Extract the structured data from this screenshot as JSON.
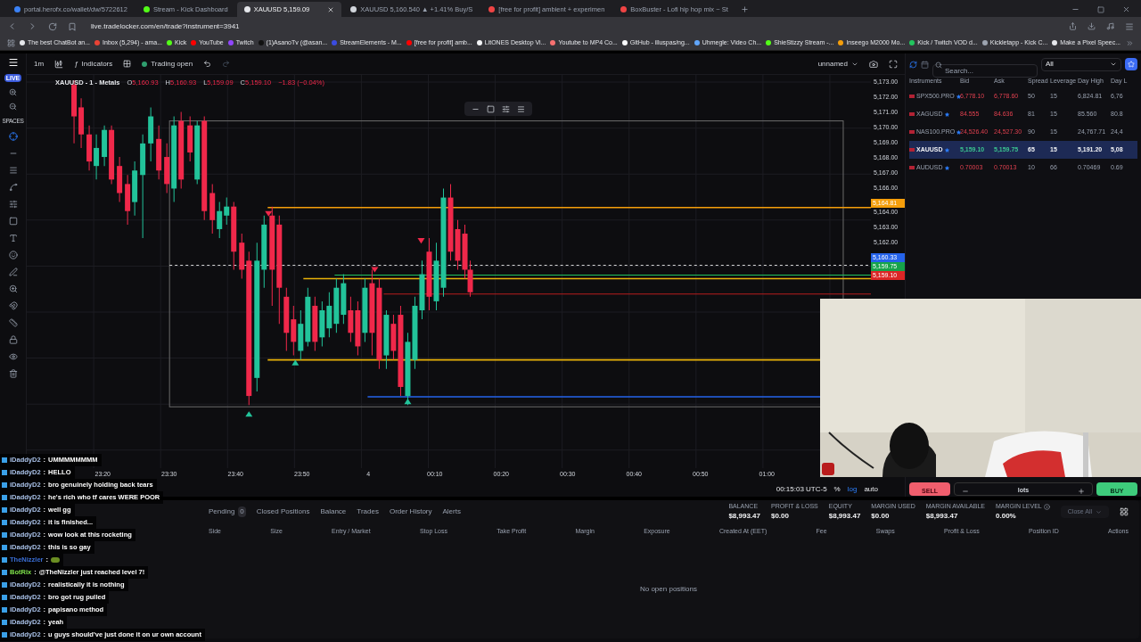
{
  "browser": {
    "tabs": [
      {
        "title": "portal.herofx.co/wallet/dw/5722612",
        "selected": false,
        "color": "#3b82f6"
      },
      {
        "title": "Stream - Kick Dashboard",
        "selected": false,
        "color": "#53fc18"
      },
      {
        "title": "XAUUSD 5,159.09",
        "selected": true,
        "color": "#e5e7eb"
      },
      {
        "title": "XAUUSD 5,160.540 ▲ +1.41% Buy/S",
        "selected": false,
        "color": "#d1d5db"
      },
      {
        "title": "[free for profit] ambient + experimen",
        "selected": false,
        "color": "#ef4444"
      },
      {
        "title": "BoxBuster - Lofi hip hop mix ~ St",
        "selected": false,
        "color": "#ef4444"
      }
    ],
    "address": "live.tradelocker.com/en/trade?instrument=3941",
    "bookmarks": [
      {
        "label": "The best ChatBot an...",
        "color": "#e5e7eb"
      },
      {
        "label": "Inbox (5,294) - ama...",
        "color": "#ea4335"
      },
      {
        "label": "Kick",
        "color": "#53fc18"
      },
      {
        "label": "YouTube",
        "color": "#ff0000"
      },
      {
        "label": "Twitch",
        "color": "#9146ff"
      },
      {
        "label": "(1)AsanoTv (@asan...",
        "color": "#111111"
      },
      {
        "label": "StreamElements - M...",
        "color": "#3b4ce0"
      },
      {
        "label": "[free for profit] amb...",
        "color": "#ff0000"
      },
      {
        "label": "LitONES Desktop Vi...",
        "color": "#f3f4f6"
      },
      {
        "label": "Youtube to MP4 Co...",
        "color": "#f87171"
      },
      {
        "label": "GitHub - illuspas/ng...",
        "color": "#f9fafb"
      },
      {
        "label": "Uhmegle: Video Ch...",
        "color": "#60a5fa"
      },
      {
        "label": "ShieStizzy Stream -...",
        "color": "#53fc18"
      },
      {
        "label": "Inseego M2000 Mo...",
        "color": "#f59e0b"
      },
      {
        "label": "Kick / Twitch VOD d...",
        "color": "#22c55e"
      },
      {
        "label": "Kickletapp - Kick C...",
        "color": "#9ca3af"
      },
      {
        "label": "Make a Pixel Speec...",
        "color": "#e5e7eb"
      }
    ]
  },
  "sidebar": {
    "badge": "LIVE",
    "section": "SPACES"
  },
  "chart_toolbar": {
    "interval": "1m",
    "function_glyph": "ƒ",
    "indicators": "Indicators",
    "status": "Trading open",
    "layout": "unnamed"
  },
  "legend": {
    "symbol": "XAUUSD - 1 - Metals",
    "values": [
      {
        "key": "O",
        "value": "5,160.93"
      },
      {
        "key": "H",
        "value": "5,160.93"
      },
      {
        "key": "L",
        "value": "5,159.09"
      },
      {
        "key": "C",
        "value": "5,159.10"
      }
    ],
    "change": "−1.83 (−0.04%)"
  },
  "price_axis": [
    {
      "label": "5,173.00",
      "kind": "tick"
    },
    {
      "label": "5,172.00",
      "kind": "tick"
    },
    {
      "label": "5,171.00",
      "kind": "tick"
    },
    {
      "label": "5,170.00",
      "kind": "tick"
    },
    {
      "label": "5,169.00",
      "kind": "tick"
    },
    {
      "label": "5,168.00",
      "kind": "tick"
    },
    {
      "label": "5,167.00",
      "kind": "tick"
    },
    {
      "label": "5,166.00",
      "kind": "tick"
    },
    {
      "label": "5,164.81",
      "kind": "badge",
      "color": "#f59e0b"
    },
    {
      "label": "5,164.00",
      "kind": "tick"
    },
    {
      "label": "5,163.00",
      "kind": "tick"
    },
    {
      "label": "5,162.00",
      "kind": "tick"
    },
    {
      "label": "5,160.33",
      "kind": "badge",
      "color": "#2563eb"
    },
    {
      "label": "5,159.75",
      "kind": "badge",
      "color": "#16a34a"
    },
    {
      "label": "5,159.10",
      "kind": "badge",
      "color": "#dc2626"
    }
  ],
  "time_axis": [
    "23:20",
    "23:30",
    "23:40",
    "23:50",
    "4",
    "00:10",
    "00:20",
    "00:30",
    "00:40",
    "00:50",
    "01:00"
  ],
  "chart_footer": {
    "clock": "00:15:03 UTC-5",
    "scales": [
      {
        "label": "%",
        "selected": false
      },
      {
        "label": "log",
        "selected": true
      },
      {
        "label": "auto",
        "selected": false
      }
    ]
  },
  "instruments": {
    "search_placeholder": "Search...",
    "filter": "All",
    "columns": [
      "Instruments",
      "Bid",
      "Ask",
      "Spread",
      "Leverage",
      "Day High",
      "Day L"
    ],
    "rows": [
      {
        "symbol": "SPX500.PRO",
        "bid": "6,778.10",
        "ask": "6,778.60",
        "spread": "50",
        "leverage": "15",
        "day_high": "6,824.81",
        "day_low": "6,76",
        "selected": false
      },
      {
        "symbol": "XAGUSD",
        "bid": "84.555",
        "ask": "84.636",
        "spread": "81",
        "leverage": "15",
        "day_high": "85.560",
        "day_low": "80.8",
        "selected": false
      },
      {
        "symbol": "NAS100.PRO",
        "bid": "24,526.40",
        "ask": "24,527.30",
        "spread": "90",
        "leverage": "15",
        "day_high": "24,767.71",
        "day_low": "24,4",
        "selected": false
      },
      {
        "symbol": "XAUUSD",
        "bid": "5,159.10",
        "ask": "5,159.75",
        "spread": "65",
        "leverage": "15",
        "day_high": "5,191.20",
        "day_low": "5,08",
        "selected": true
      },
      {
        "symbol": "AUDUSD",
        "bid": "0.70003",
        "ask": "0.70013",
        "spread": "10",
        "leverage": "66",
        "day_high": "0.70469",
        "day_low": "0.69",
        "selected": false
      }
    ]
  },
  "order_bar": {
    "sell": "SELL",
    "lots": "lots",
    "buy": "BUY"
  },
  "positions": {
    "tabs": [
      {
        "label": "Pending",
        "count": "0",
        "selected": false
      },
      {
        "label": "Closed Positions",
        "selected": false
      },
      {
        "label": "Balance",
        "selected": false
      },
      {
        "label": "Trades",
        "selected": false
      },
      {
        "label": "Order History",
        "selected": false
      },
      {
        "label": "Alerts",
        "selected": false
      }
    ],
    "summary": [
      {
        "label": "BALANCE",
        "value": "$8,993.47"
      },
      {
        "label": "PROFIT & LOSS",
        "value": "$0.00"
      },
      {
        "label": "EQUITY",
        "value": "$8,993.47"
      },
      {
        "label": "MARGIN USED",
        "value": "$0.00"
      },
      {
        "label": "MARGIN AVAILABLE",
        "value": "$8,993.47"
      },
      {
        "label": "MARGIN LEVEL",
        "value": "0.00%"
      }
    ],
    "close_all": {
      "label": "Close All",
      "disabled": true
    },
    "columns": [
      "Side",
      "Size",
      "Entry / Market",
      "Stop Loss",
      "Take Profit",
      "Margin",
      "Exposure",
      "Created At (EET)",
      "Fee",
      "Swaps",
      "Profit & Loss",
      "Position ID",
      "Actions"
    ],
    "empty": "No open positions"
  },
  "chat": {
    "separator": ":",
    "messages": [
      {
        "user": "iDaddyD2",
        "text": "UMMMMMMMM",
        "color": "#a9c1e8",
        "kind": "text"
      },
      {
        "user": "iDaddyD2",
        "text": "HELLO",
        "color": "#a9c1e8",
        "kind": "text"
      },
      {
        "user": "iDaddyD2",
        "text": "bro genuinely holding back tears",
        "color": "#a9c1e8",
        "kind": "text"
      },
      {
        "user": "iDaddyD2",
        "text": "he's rich who tf cares WERE POOR",
        "color": "#a9c1e8",
        "kind": "text"
      },
      {
        "user": "iDaddyD2",
        "text": "well gg",
        "color": "#a9c1e8",
        "kind": "text"
      },
      {
        "user": "iDaddyD2",
        "text": "it is finished...",
        "color": "#a9c1e8",
        "kind": "text"
      },
      {
        "user": "iDaddyD2",
        "text": "wow look at this rocketing",
        "color": "#a9c1e8",
        "kind": "text"
      },
      {
        "user": "iDaddyD2",
        "text": "this is so gay",
        "color": "#a9c1e8",
        "kind": "text"
      },
      {
        "user": "TheNizzler",
        "color": "#3b6fd6",
        "kind": "emote"
      },
      {
        "user": "BotRix",
        "text": "@TheNizzler just reached level 7!",
        "color": "#7ee04a",
        "kind": "text"
      },
      {
        "user": "iDaddyD2",
        "text": "realistically it is nothing",
        "color": "#a9c1e8",
        "kind": "text"
      },
      {
        "user": "iDaddyD2",
        "text": "bro got rug pulled",
        "color": "#a9c1e8",
        "kind": "text"
      },
      {
        "user": "iDaddyD2",
        "text": "papisano method",
        "color": "#a9c1e8",
        "kind": "text"
      },
      {
        "user": "iDaddyD2",
        "text": "yeah",
        "color": "#a9c1e8",
        "kind": "text"
      },
      {
        "user": "iDaddyD2",
        "text": "u guys should've just done it on ur own account",
        "color": "#a9c1e8",
        "kind": "text"
      }
    ]
  }
}
